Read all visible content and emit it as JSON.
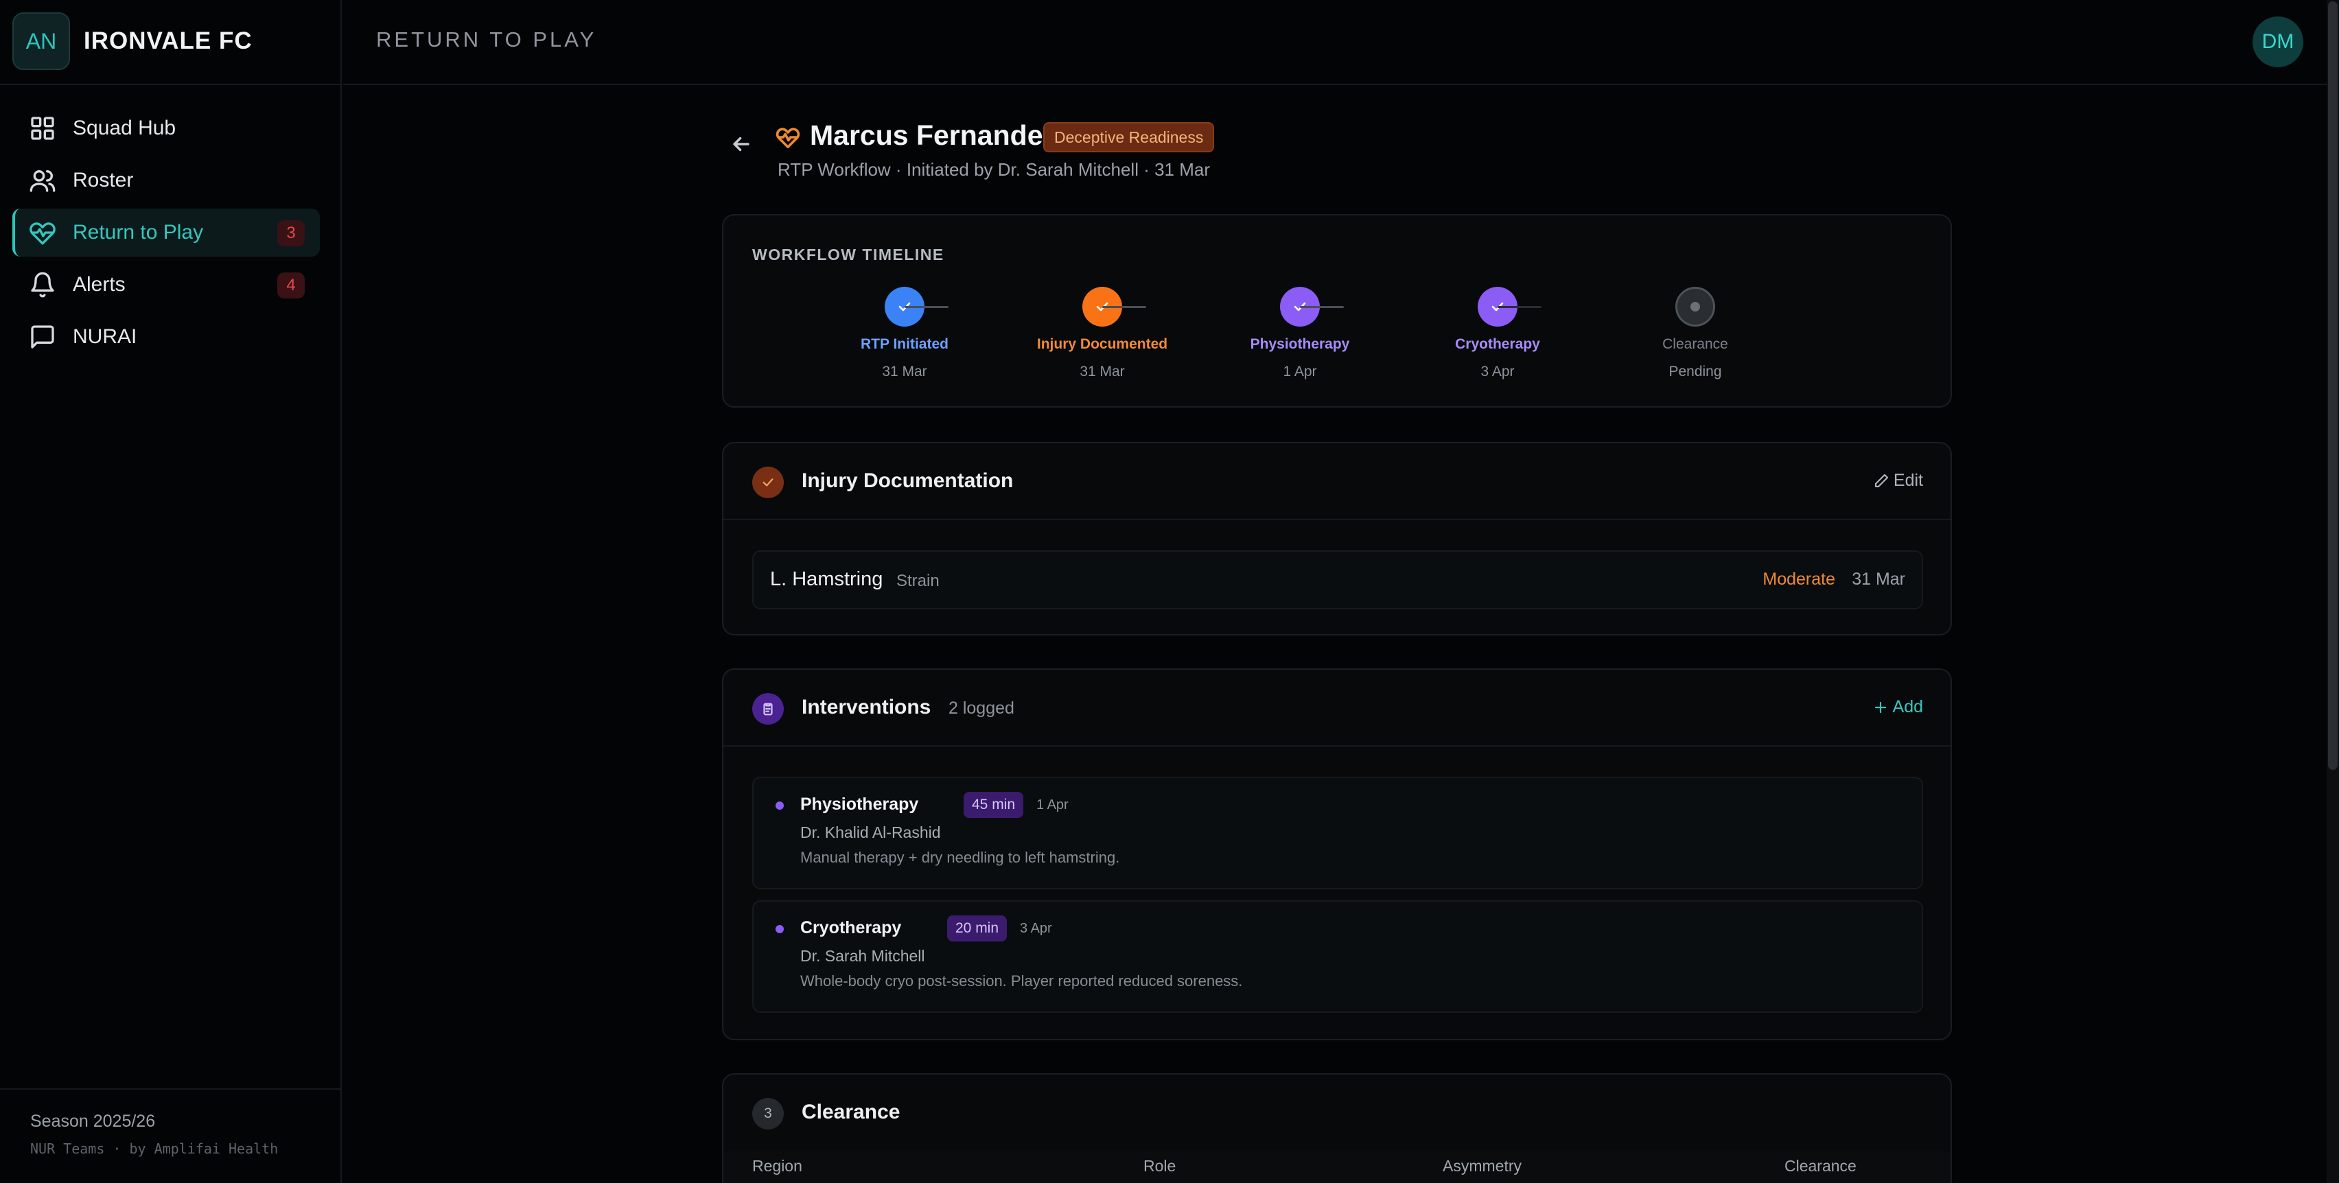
{
  "brand": {
    "initials": "AN",
    "name": "IRONVALE FC"
  },
  "nav": {
    "items": [
      {
        "label": "Squad Hub",
        "icon": "grid-icon"
      },
      {
        "label": "Roster",
        "icon": "users-icon"
      },
      {
        "label": "Return to Play",
        "icon": "heart-pulse-icon",
        "badge": "3",
        "active": true
      },
      {
        "label": "Alerts",
        "icon": "bell-icon",
        "badge": "4"
      },
      {
        "label": "NURAI",
        "icon": "chat-icon"
      }
    ]
  },
  "footer": {
    "season": "Season 2025/26",
    "credit": "NUR Teams · by Amplifai Health"
  },
  "topbar": {
    "title": "RETURN TO PLAY",
    "user_initials": "DM"
  },
  "player": {
    "name": "Marcus Fernandez",
    "status": "Deceptive Readiness",
    "subtitle": "RTP Workflow · Initiated by Dr. Sarah Mitchell · 31 Mar"
  },
  "timeline": {
    "label": "WORKFLOW TIMELINE",
    "steps": [
      {
        "label": "RTP Initiated",
        "date": "31 Mar",
        "color": "#3b82f6",
        "state": "done"
      },
      {
        "label": "Injury Documented",
        "date": "31 Mar",
        "color": "#f97316",
        "state": "done"
      },
      {
        "label": "Physiotherapy",
        "date": "1 Apr",
        "color": "#8b5cf6",
        "state": "done"
      },
      {
        "label": "Cryotherapy",
        "date": "3 Apr",
        "color": "#8b5cf6",
        "state": "done"
      },
      {
        "label": "Clearance",
        "date": "Pending",
        "color": "#6b7078",
        "state": "pending"
      }
    ]
  },
  "injury": {
    "title": "Injury Documentation",
    "edit_label": "Edit",
    "region": "L. Hamstring",
    "type": "Strain",
    "severity": "Moderate",
    "date": "31 Mar"
  },
  "interventions": {
    "title": "Interventions",
    "count": "2 logged",
    "add_label": "Add",
    "items": [
      {
        "type": "Physiotherapy",
        "duration": "45 min",
        "date": "1 Apr",
        "clinician": "Dr. Khalid Al-Rashid",
        "note": "Manual therapy + dry needling to left hamstring."
      },
      {
        "type": "Cryotherapy",
        "duration": "20 min",
        "date": "3 Apr",
        "clinician": "Dr. Sarah Mitchell",
        "note": "Whole-body cryo post-session. Player reported reduced soreness."
      }
    ]
  },
  "clearance": {
    "number": "3",
    "title": "Clearance",
    "columns": [
      "Region",
      "Role",
      "Asymmetry",
      "Clearance"
    ]
  },
  "colors": {
    "accent": "#2cc5bd",
    "warning": "#ef8a33",
    "purple": "#8b5cf6",
    "danger": "#e24a4f"
  }
}
